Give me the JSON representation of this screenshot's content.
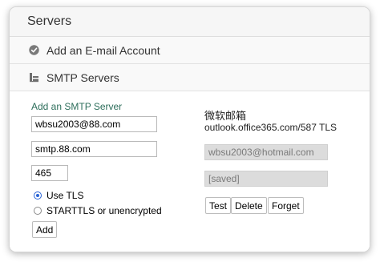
{
  "header": {
    "title": "Servers"
  },
  "rows": [
    {
      "label": "Add an E-mail Account",
      "icon": "check-circle-icon"
    },
    {
      "label": "SMTP Servers",
      "icon": "server-doc-icon"
    }
  ],
  "smtp_form": {
    "section_title": "Add an SMTP Server",
    "username_value": "wbsu2003@88.com",
    "host_value": "smtp.88.com",
    "port_value": "465",
    "tls_options": [
      {
        "label": "Use TLS",
        "checked": true
      },
      {
        "label": "STARTTLS or unencrypted",
        "checked": false
      }
    ],
    "add_label": "Add"
  },
  "saved_server": {
    "name": "微软邮箱",
    "address": "outlook.office365.com/587 TLS",
    "username_value": "wbsu2003@hotmail.com",
    "password_value": "[saved]",
    "buttons": {
      "test_label": "Test",
      "delete_label": "Delete",
      "forget_label": "Forget"
    }
  },
  "colors": {
    "accent_green": "#2d6e5b",
    "radio_blue": "#2a64d6"
  }
}
